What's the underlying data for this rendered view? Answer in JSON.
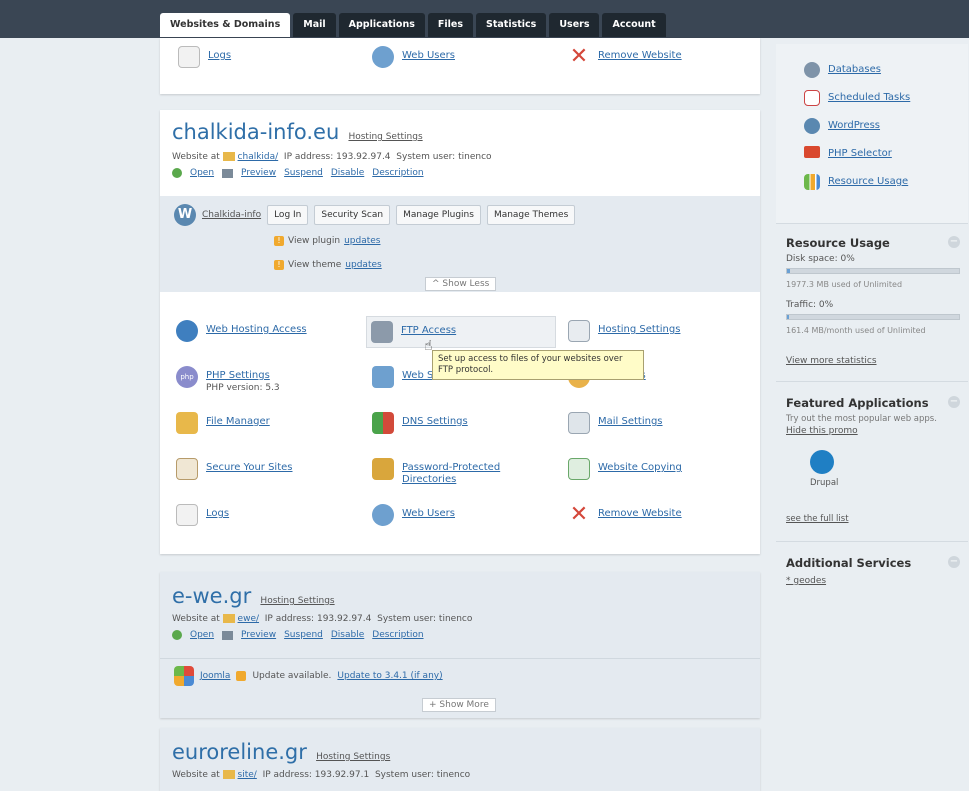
{
  "tabs": [
    "Websites & Domains",
    "Mail",
    "Applications",
    "Files",
    "Statistics",
    "Users",
    "Account"
  ],
  "top_panel": {
    "items": [
      "Logs",
      "Web Users",
      "Remove Website"
    ]
  },
  "domain1": {
    "name": "chalkida-info.eu",
    "hosting_link": "Hosting Settings",
    "website_at_label": "Website at",
    "folder": "chalkida/",
    "ip_label": "IP address:",
    "ip": "193.92.97.4",
    "sysuser_label": "System user:",
    "sysuser": "tinenco",
    "actions": [
      "Open",
      "Preview",
      "Suspend",
      "Disable",
      "Description"
    ],
    "wp": {
      "name": "Chalkida-info",
      "buttons": [
        "Log In",
        "Security Scan",
        "Manage Plugins",
        "Manage Themes"
      ],
      "plugins_prefix": "View plugin",
      "plugins_link": "updates",
      "themes_prefix": "View theme",
      "themes_link": "updates"
    },
    "show_less": "^ Show Less",
    "grid": {
      "web_hosting_access": "Web Hosting Access",
      "ftp_access": "FTP Access",
      "hosting_settings": "Hosting Settings",
      "php_settings": "PHP Settings",
      "php_version": "PHP version: 5.3",
      "web_stats": "Web S",
      "file_manager": "File Manager",
      "dns_settings": "DNS Settings",
      "mail_settings": "Mail Settings",
      "secure_sites": "Secure Your Sites",
      "protected_dirs_1": "Password-Protected",
      "protected_dirs_2": "Directories",
      "website_copying": "Website Copying",
      "logs": "Logs",
      "web_users": "Web Users",
      "remove_website": "Remove Website",
      "apps_partial": "ons"
    }
  },
  "tooltip": "Set up access to files of your websites over FTP protocol.",
  "domain2": {
    "name": "e-we.gr",
    "hosting_link": "Hosting Settings",
    "website_at_label": "Website at",
    "folder": "ewe/",
    "ip_label": "IP address:",
    "ip": "193.92.97.4",
    "sysuser_label": "System user:",
    "sysuser": "tinenco",
    "actions": [
      "Open",
      "Preview",
      "Suspend",
      "Disable",
      "Description"
    ],
    "joomla": {
      "name": "Joomla",
      "update_text": "Update available.",
      "update_link": "Update to 3.4.1 (if any)"
    },
    "show_more": "+ Show More"
  },
  "domain3": {
    "name": "euroreline.gr",
    "hosting_link": "Hosting Settings",
    "website_at_label": "Website at",
    "folder": "site/",
    "ip_label": "IP address:",
    "ip": "193.92.97.1",
    "sysuser_label": "System user:",
    "sysuser": "tinenco"
  },
  "sidebar": {
    "links": [
      "Databases",
      "Scheduled Tasks",
      "WordPress",
      "PHP Selector",
      "Resource Usage"
    ],
    "resource": {
      "title": "Resource Usage",
      "disk_label": "Disk space: 0%",
      "disk_detail": "1977.3 MB used of Unlimited",
      "traffic_label": "Traffic: 0%",
      "traffic_detail": "161.4 MB/month used of Unlimited",
      "disk_fraction": 0.02,
      "traffic_fraction": 0.01,
      "more_link": "View more statistics"
    },
    "featured": {
      "title": "Featured Applications",
      "desc": "Try out the most popular web apps.",
      "hide": "Hide this promo",
      "app_name": "Drupal",
      "see_all": "see the full list"
    },
    "additional": {
      "title": "Additional Services",
      "link": "* geodes"
    }
  },
  "colors": {
    "topbar": "#3a4654",
    "link": "#2d6aa8",
    "page_bg": "#e9eef2",
    "tooltip_bg": "#fffcc8"
  }
}
